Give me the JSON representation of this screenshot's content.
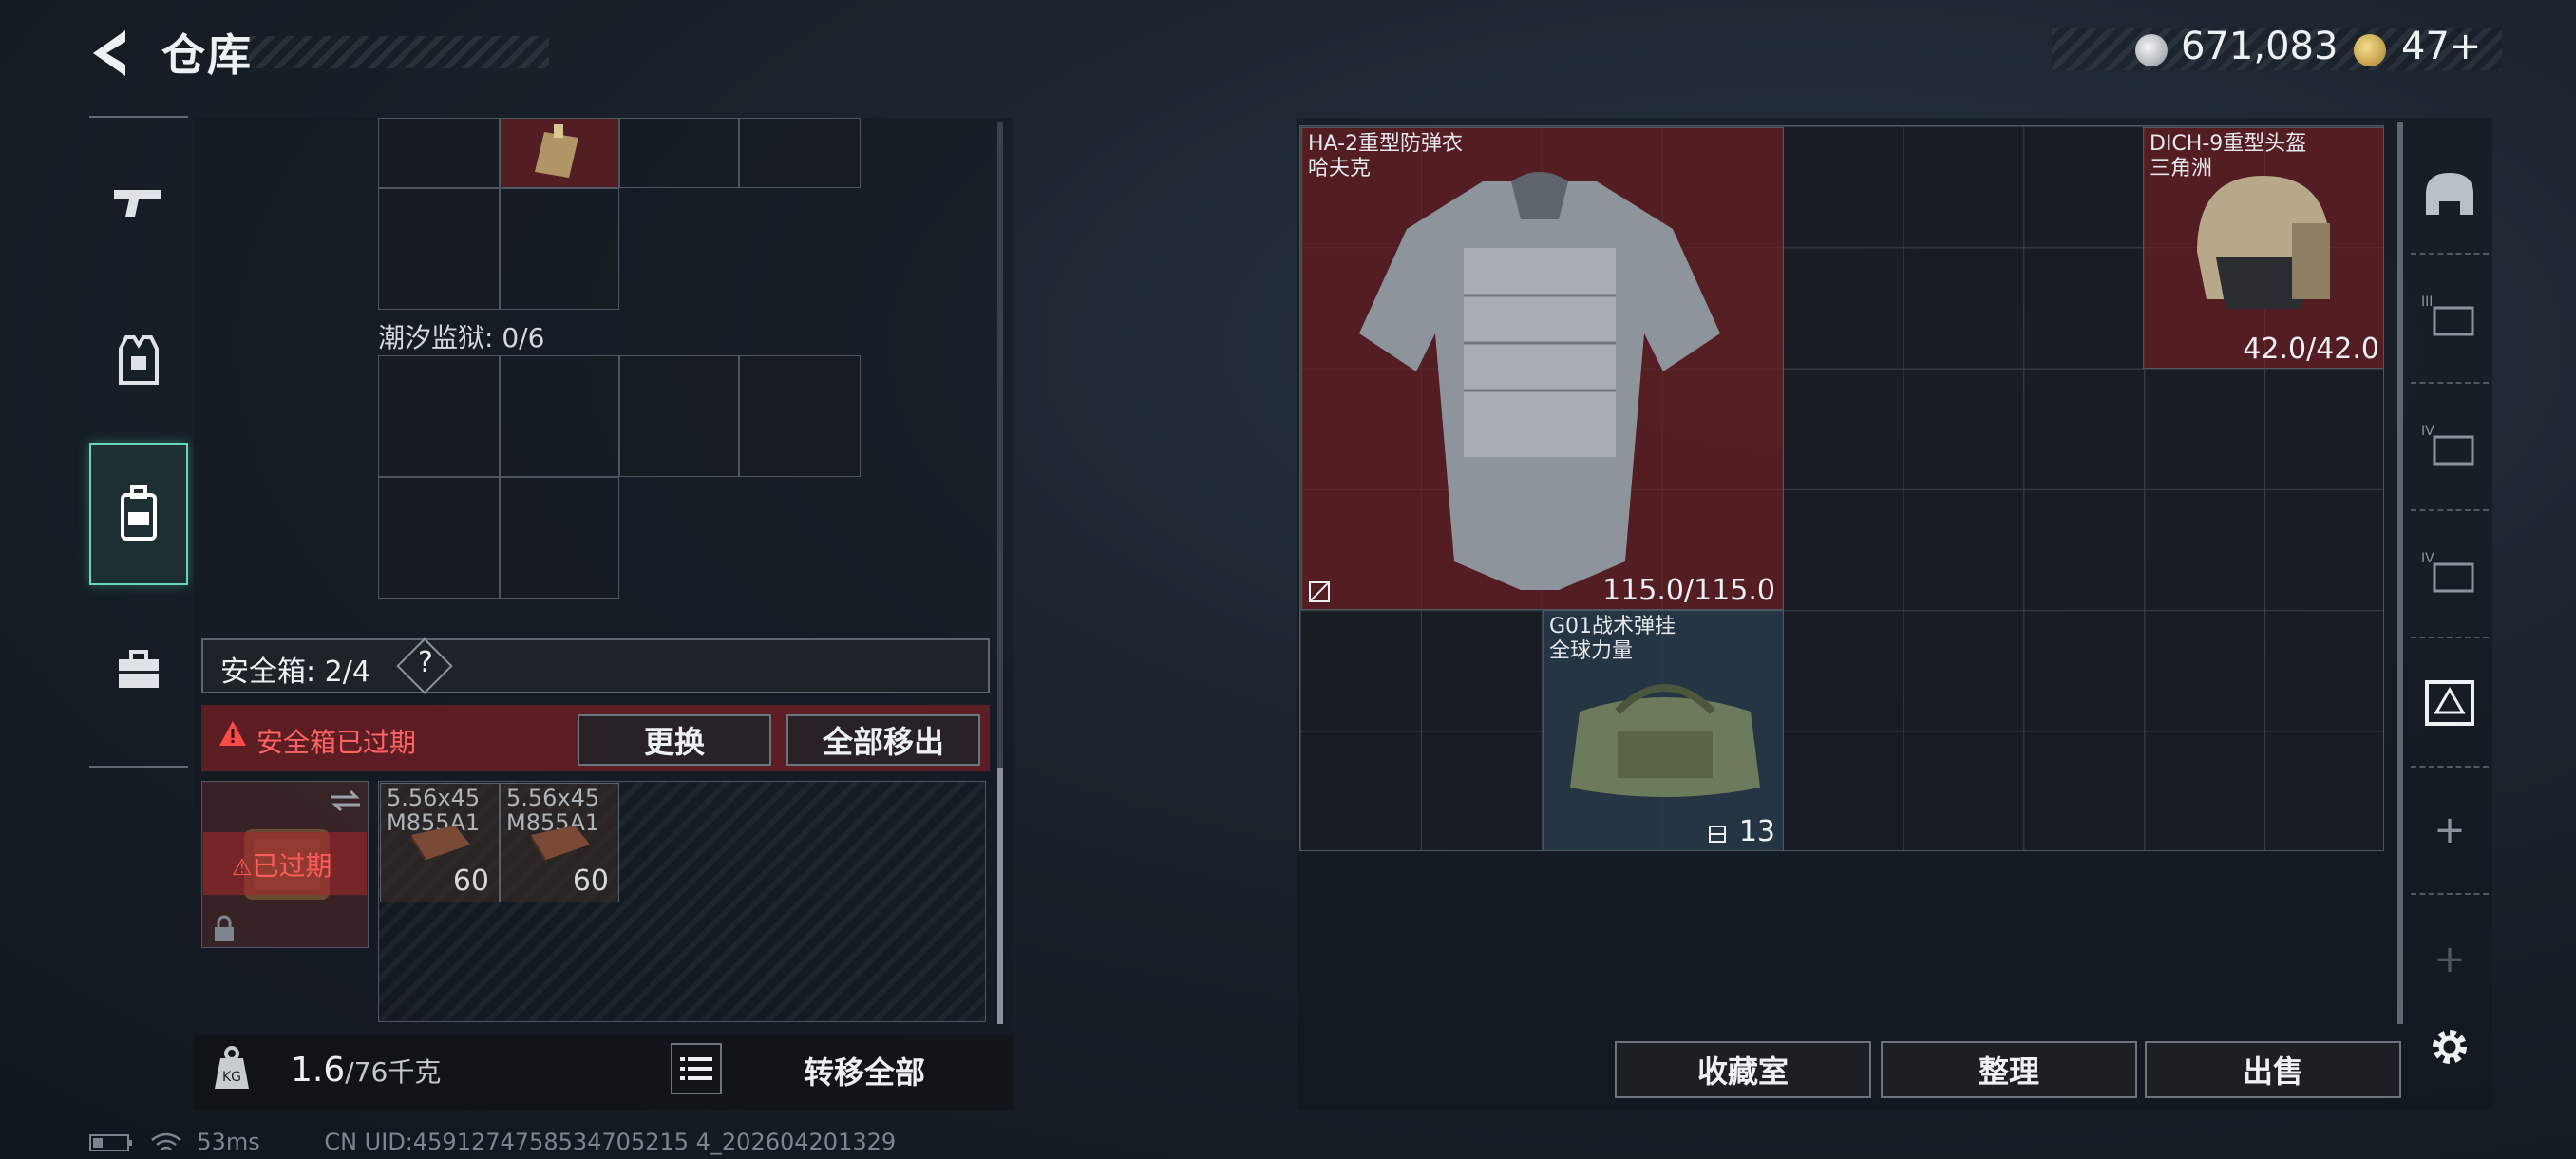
{
  "header": {
    "title": "仓库",
    "currency": [
      {
        "icon": "silver-coin-icon",
        "value": "671,083"
      },
      {
        "icon": "gold-coin-icon",
        "value": "47+"
      }
    ]
  },
  "left_nav": {
    "items": [
      {
        "name": "weapon",
        "icon": "gun-icon",
        "active": false
      },
      {
        "name": "vest",
        "icon": "vest-icon",
        "active": false
      },
      {
        "name": "backpack",
        "icon": "backpack-icon",
        "active": true
      },
      {
        "name": "case",
        "icon": "briefcase-icon",
        "active": false
      }
    ]
  },
  "backpack": {
    "section_label": "潮汐监狱: 0/6",
    "safe": {
      "label": "安全箱: 2/4",
      "help": "?",
      "expired_message": "安全箱已过期",
      "replace_button": "更换",
      "move_all_button": "全部移出",
      "slot_badge": "已过期",
      "items": [
        {
          "name": "5.56x45\nM855A1",
          "count": "60"
        },
        {
          "name": "5.56x45\nM855A1",
          "count": "60"
        }
      ]
    },
    "weight_value": "1.6",
    "weight_max": "/76千克",
    "transfer_all": "转移全部"
  },
  "equipment": {
    "armor": {
      "name": "HA-2重型防弹衣",
      "brand": "哈夫克",
      "durability": "115.0/115.0"
    },
    "helmet": {
      "name": "DICH-9重型头盔",
      "brand": "三角洲",
      "durability": "42.0/42.0"
    },
    "rig": {
      "name": "G01战术弹挂",
      "brand": "全球力量",
      "capacity": "13"
    },
    "buttons": {
      "collection": "收藏室",
      "organize": "整理",
      "sell": "出售"
    }
  },
  "status": {
    "ping": "53ms",
    "uid": "CN UID:4591274758534705215 4_202604201329"
  },
  "colors": {
    "accent": "#67d7b8",
    "danger": "#ff5a5a",
    "equip_red": "#6e1e24"
  }
}
